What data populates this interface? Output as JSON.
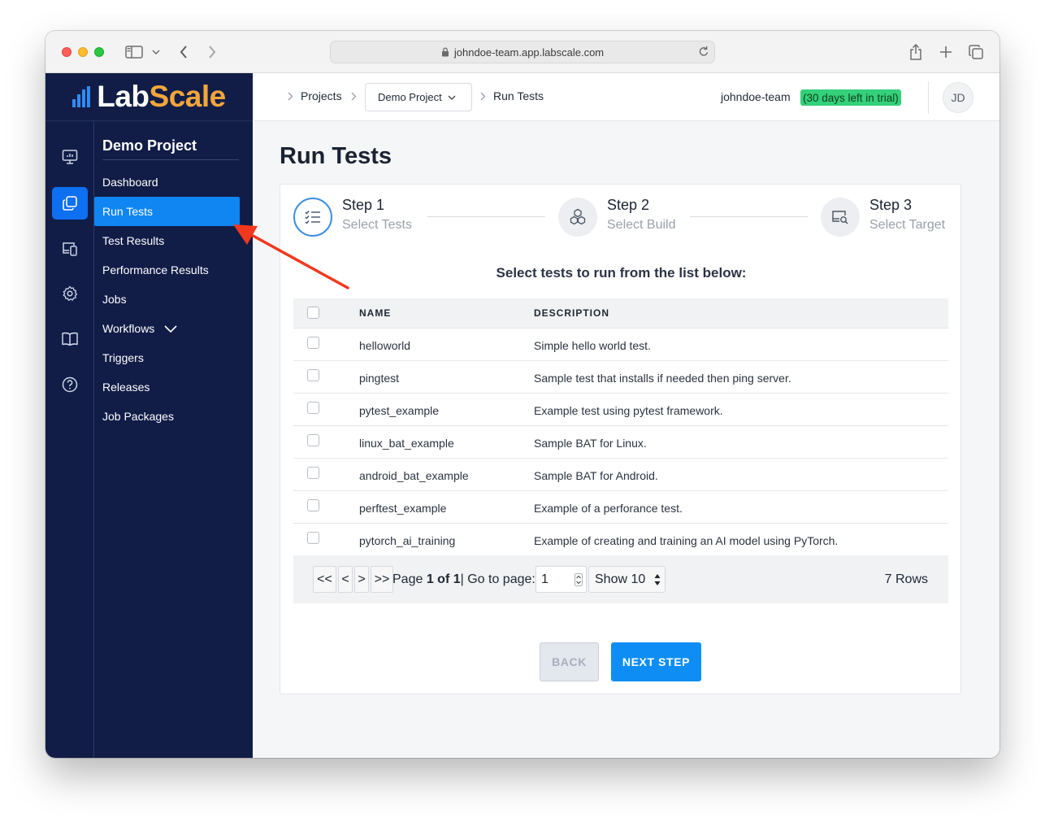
{
  "browser": {
    "url": "johndoe-team.app.labscale.com"
  },
  "logo": {
    "part1": "Lab",
    "part2": "Scale"
  },
  "rail": [
    {
      "icon": "dashboard-monitor-icon"
    },
    {
      "icon": "projects-copy-icon",
      "active": true
    },
    {
      "icon": "devices-icon"
    },
    {
      "icon": "gear-icon"
    },
    {
      "icon": "book-icon"
    },
    {
      "icon": "help-icon"
    }
  ],
  "sidebar": {
    "title": "Demo Project",
    "items": [
      {
        "label": "Dashboard"
      },
      {
        "label": "Run Tests",
        "active": true
      },
      {
        "label": "Test Results"
      },
      {
        "label": "Performance Results"
      },
      {
        "label": "Jobs"
      },
      {
        "label": "Workflows"
      },
      {
        "label": "Triggers"
      },
      {
        "label": "Releases"
      },
      {
        "label": "Job Packages"
      }
    ]
  },
  "topbar": {
    "breadcrumb": {
      "projects": "Projects",
      "project_select": "Demo Project",
      "current": "Run Tests"
    },
    "team": "johndoe-team",
    "trial": "(30 days left in trial)",
    "avatar_initials": "JD"
  },
  "page": {
    "title": "Run Tests",
    "steps": [
      {
        "label": "Step 1",
        "sub": "Select Tests"
      },
      {
        "label": "Step 2",
        "sub": "Select Build"
      },
      {
        "label": "Step 3",
        "sub": "Select Target"
      }
    ],
    "instruction": "Select tests to run from the list below:",
    "table": {
      "columns": [
        "NAME",
        "DESCRIPTION"
      ],
      "rows": [
        {
          "name": "helloworld",
          "description": "Simple hello world test."
        },
        {
          "name": "pingtest",
          "description": "Sample test that installs if needed then ping server."
        },
        {
          "name": "pytest_example",
          "description": "Example test using pytest framework."
        },
        {
          "name": "linux_bat_example",
          "description": "Sample BAT for Linux."
        },
        {
          "name": "android_bat_example",
          "description": "Sample BAT for Android."
        },
        {
          "name": "perftest_example",
          "description": "Example of a perforance test."
        },
        {
          "name": "pytorch_ai_training",
          "description": "Example of creating and training an AI model using PyTorch."
        }
      ]
    },
    "pagination": {
      "first": "<<",
      "prev": "<",
      "next": ">",
      "last": ">>",
      "page_prefix": "Page",
      "page_of": "1 of 1",
      "goto_label": "| Go to page:",
      "goto_value": "1",
      "show": "Show 10",
      "rows": "7 Rows"
    },
    "buttons": {
      "back": "BACK",
      "next": "NEXT STEP"
    }
  },
  "colors": {
    "sidebar_bg": "#111d47",
    "accent_blue": "#0e8ef5",
    "logo_orange": "#f3a53b",
    "trial_green": "#34d07a",
    "annotation_arrow": "#f2381d"
  }
}
